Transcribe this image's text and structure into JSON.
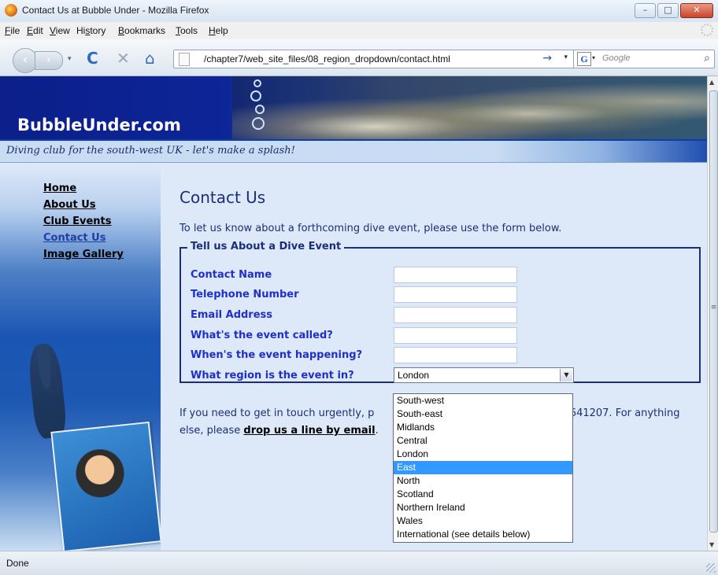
{
  "window": {
    "title": "Contact Us at Bubble Under - Mozilla Firefox",
    "buttons": {
      "minimize": "–",
      "maximize": "□",
      "close": "✕"
    }
  },
  "menu": {
    "items": [
      {
        "label": "File",
        "accel": "F"
      },
      {
        "label": "Edit",
        "accel": "E"
      },
      {
        "label": "View",
        "accel": "V"
      },
      {
        "label": "History",
        "accel": "s"
      },
      {
        "label": "Bookmarks",
        "accel": "B"
      },
      {
        "label": "Tools",
        "accel": "T"
      },
      {
        "label": "Help",
        "accel": "H"
      }
    ]
  },
  "toolbar": {
    "back": "‹",
    "forward": "›",
    "dropdown": "▾",
    "reload": "C",
    "stop": "✕",
    "home": "⌂",
    "url": "/chapter7/web_site_files/08_region_dropdown/contact.html",
    "go": "→",
    "url_history": "▾",
    "search_engine": "G",
    "search_drop": "▾",
    "search_placeholder": "Google",
    "search_icon": "⌕"
  },
  "site": {
    "name": "BubbleUnder.com",
    "tagline": "Diving club for the south-west UK - let's make a splash!"
  },
  "nav": [
    {
      "label": "Home",
      "current": false
    },
    {
      "label": "About Us",
      "current": false
    },
    {
      "label": "Club Events",
      "current": false
    },
    {
      "label": "Contact Us",
      "current": true
    },
    {
      "label": "Image Gallery",
      "current": false
    }
  ],
  "page": {
    "title": "Contact Us",
    "intro": "To let us know about a forthcoming dive event, please use the form below.",
    "legend": "Tell us About a Dive Event",
    "fields": [
      {
        "label": "Contact Name",
        "value": ""
      },
      {
        "label": "Telephone Number",
        "value": ""
      },
      {
        "label": "Email Address",
        "value": ""
      },
      {
        "label": "What's the event called?",
        "value": ""
      },
      {
        "label": "When's the event happening?",
        "value": ""
      }
    ],
    "region": {
      "label": "What region is the event in?",
      "value": "London",
      "arrow": "▼",
      "options": [
        "South-west",
        "South-east",
        "Midlands",
        "Central",
        "London",
        "East",
        "North",
        "Scotland",
        "Northern Ireland",
        "Wales",
        "International (see details below)"
      ],
      "highlighted": "East"
    },
    "contact_line1_start": "If you need to get in touch urgently, p",
    "contact_line1_end": "3 641207. For anything",
    "contact_line2_start": "else, please ",
    "contact_link": "drop us a line by email",
    "contact_line2_end": "."
  },
  "scrollbar": {
    "up": "▲",
    "down": "▼",
    "grip": "≡"
  },
  "status": {
    "text": "Done"
  },
  "colors": {
    "page_bg": "#dde8f8",
    "heading": "#1b2e7a",
    "label": "#1f2fc9",
    "banner": "#0c1f8a",
    "highlight": "#3399ff"
  }
}
